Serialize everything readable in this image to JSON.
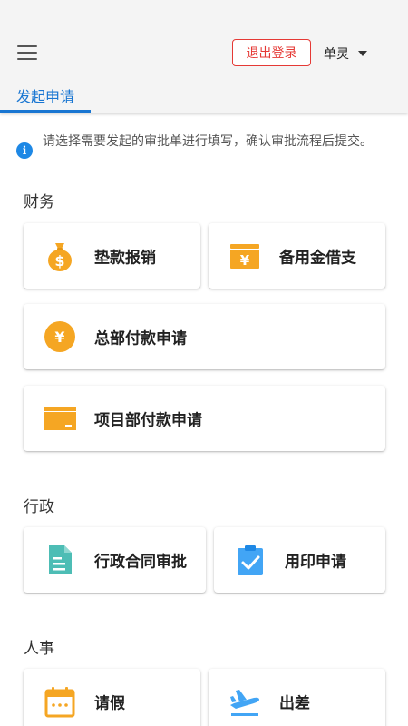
{
  "header": {
    "logout_label": "退出登录",
    "user_name": "单灵",
    "tab_label": "发起申请"
  },
  "notice": {
    "text": "请选择需要发起的审批单进行填写，确认审批流程后提交。"
  },
  "sections": {
    "finance": {
      "title": "财务",
      "items": [
        {
          "label": "垫款报销",
          "icon": "money-bag-icon"
        },
        {
          "label": "备用金借支",
          "icon": "yen-wallet-icon"
        },
        {
          "label": "总部付款申请",
          "icon": "yen-coin-icon"
        },
        {
          "label": "项目部付款申请",
          "icon": "card-icon"
        }
      ]
    },
    "admin": {
      "title": "行政",
      "items": [
        {
          "label": "行政合同审批",
          "icon": "document-icon"
        },
        {
          "label": "用印申请",
          "icon": "clipboard-check-icon"
        }
      ]
    },
    "hr": {
      "title": "人事",
      "items": [
        {
          "label": "请假",
          "icon": "calendar-icon"
        },
        {
          "label": "出差",
          "icon": "airplane-icon"
        }
      ]
    }
  },
  "colors": {
    "accent": "#1976d2",
    "logout": "#e53935",
    "orange": "#f5a623",
    "teal": "#4dbdb5",
    "blue_icon": "#42a5f5"
  }
}
